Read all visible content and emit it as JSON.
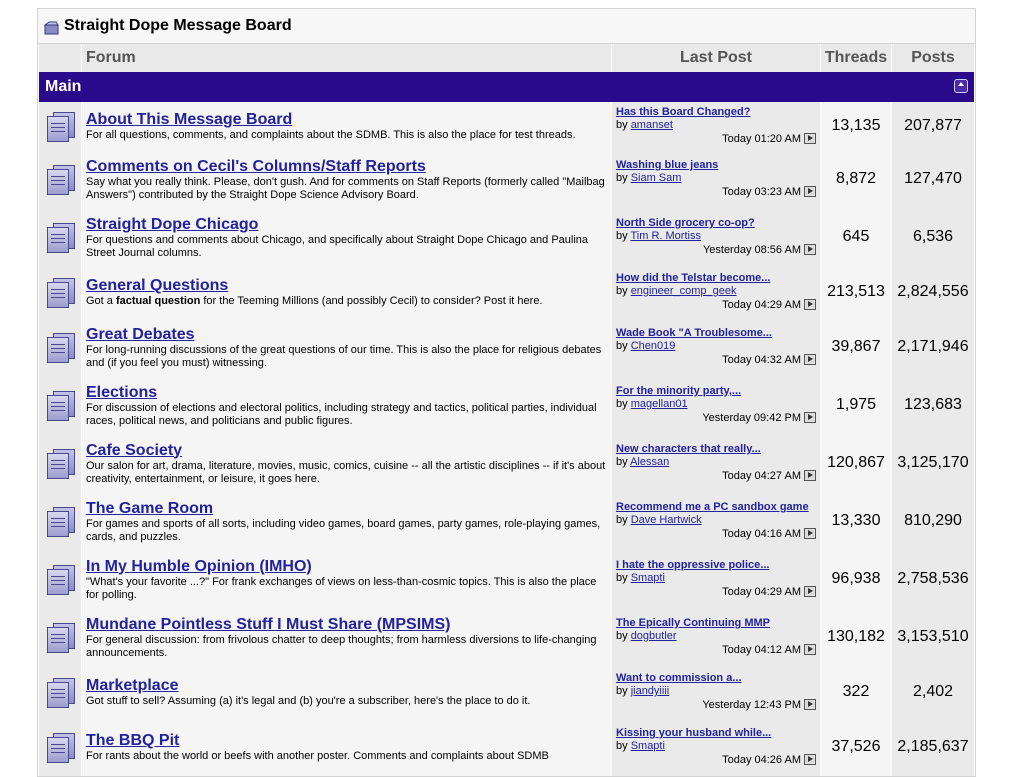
{
  "board": {
    "title": "Straight Dope Message Board"
  },
  "columns": {
    "forum": "Forum",
    "last_post": "Last Post",
    "threads": "Threads",
    "posts": "Posts"
  },
  "category": {
    "name": "Main"
  },
  "by_label": "by",
  "forums": [
    {
      "name": "About This Message Board",
      "desc": "For all questions, comments, and complaints about the SDMB. This is also the place for test threads.",
      "last_title": "Has this Board Changed?",
      "last_by": "amanset",
      "last_time": "Today 01:20 AM",
      "threads": "13,135",
      "posts": "207,877"
    },
    {
      "name": "Comments on Cecil's Columns/Staff Reports",
      "desc": "Say what you really think. Please, don't gush. And for comments on Staff Reports (formerly called \"Mailbag Answers\") contributed by the Straight Dope Science Advisory Board.",
      "last_title": "Washing blue jeans",
      "last_by": "Siam Sam",
      "last_time": "Today 03:23 AM",
      "threads": "8,872",
      "posts": "127,470"
    },
    {
      "name": "Straight Dope Chicago",
      "desc": "For questions and comments about Chicago, and specifically about Straight Dope Chicago and Paulina Street Journal columns.",
      "last_title": "North Side grocery co-op?",
      "last_by": "Tim R. Mortiss",
      "last_time": "Yesterday 08:56 AM",
      "threads": "645",
      "posts": "6,536"
    },
    {
      "name": "General Questions",
      "desc_pre": "Got a ",
      "desc_bold": "factual question",
      "desc_post": " for the Teeming Millions (and possibly Cecil) to consider? Post it here.",
      "last_title": "How did the Telstar become...",
      "last_by": "engineer_comp_geek",
      "last_time": "Today 04:29 AM",
      "threads": "213,513",
      "posts": "2,824,556"
    },
    {
      "name": "Great Debates",
      "desc": "For long-running discussions of the great questions of our time. This is also the place for religious debates and (if you feel you must) witnessing.",
      "last_title": "Wade Book \"A Troublesome...",
      "last_by": "Chen019",
      "last_time": "Today 04:32 AM",
      "threads": "39,867",
      "posts": "2,171,946"
    },
    {
      "name": "Elections",
      "desc": "For discussion of elections and electoral politics, including strategy and tactics, political parties, individual races, political news, and politicians and public figures.",
      "last_title": "For the minority party,...",
      "last_by": "magellan01",
      "last_time": "Yesterday 09:42 PM",
      "threads": "1,975",
      "posts": "123,683"
    },
    {
      "name": "Cafe Society",
      "desc": "Our salon for art, drama, literature, movies, music, comics, cuisine -- all the artistic disciplines -- if it's about creativity, entertainment, or leisure, it goes here.",
      "last_title": "New characters that really...",
      "last_by": "Alessan",
      "last_time": "Today 04:27 AM",
      "threads": "120,867",
      "posts": "3,125,170"
    },
    {
      "name": "The Game Room",
      "desc": "For games and sports of all sorts, including video games, board games, party games, role-playing games, cards, and puzzles.",
      "last_title": "Recommend me a PC sandbox game",
      "last_by": "Dave Hartwick",
      "last_time": "Today 04:16 AM",
      "threads": "13,330",
      "posts": "810,290"
    },
    {
      "name": "In My Humble Opinion (IMHO)",
      "desc": "\"What's your favorite ...?\" For frank exchanges of views on less-than-cosmic topics. This is also the place for polling.",
      "last_title": "I hate the oppressive police...",
      "last_by": "Smapti",
      "last_time": "Today 04:29 AM",
      "threads": "96,938",
      "posts": "2,758,536"
    },
    {
      "name": "Mundane Pointless Stuff I Must Share (MPSIMS)",
      "desc": "For general discussion: from frivolous chatter to deep thoughts; from harmless diversions to life-changing announcements.",
      "last_title": "The Epically Continuing MMP",
      "last_by": "dogbutler",
      "last_time": "Today 04:12 AM",
      "threads": "130,182",
      "posts": "3,153,510"
    },
    {
      "name": "Marketplace",
      "desc": "Got stuff to sell? Assuming (a) it's legal and (b) you're a subscriber, here's the place to do it.",
      "last_title": "Want to commission a...",
      "last_by": "jiandyiiii",
      "last_time": "Yesterday 12:43 PM",
      "threads": "322",
      "posts": "2,402"
    },
    {
      "name": "The BBQ Pit",
      "desc": "For rants about the world or beefs with another poster. Comments and complaints about SDMB",
      "last_title": "Kissing your husband while...",
      "last_by": "Smapti",
      "last_time": "Today 04:26 AM",
      "threads": "37,526",
      "posts": "2,185,637"
    }
  ]
}
